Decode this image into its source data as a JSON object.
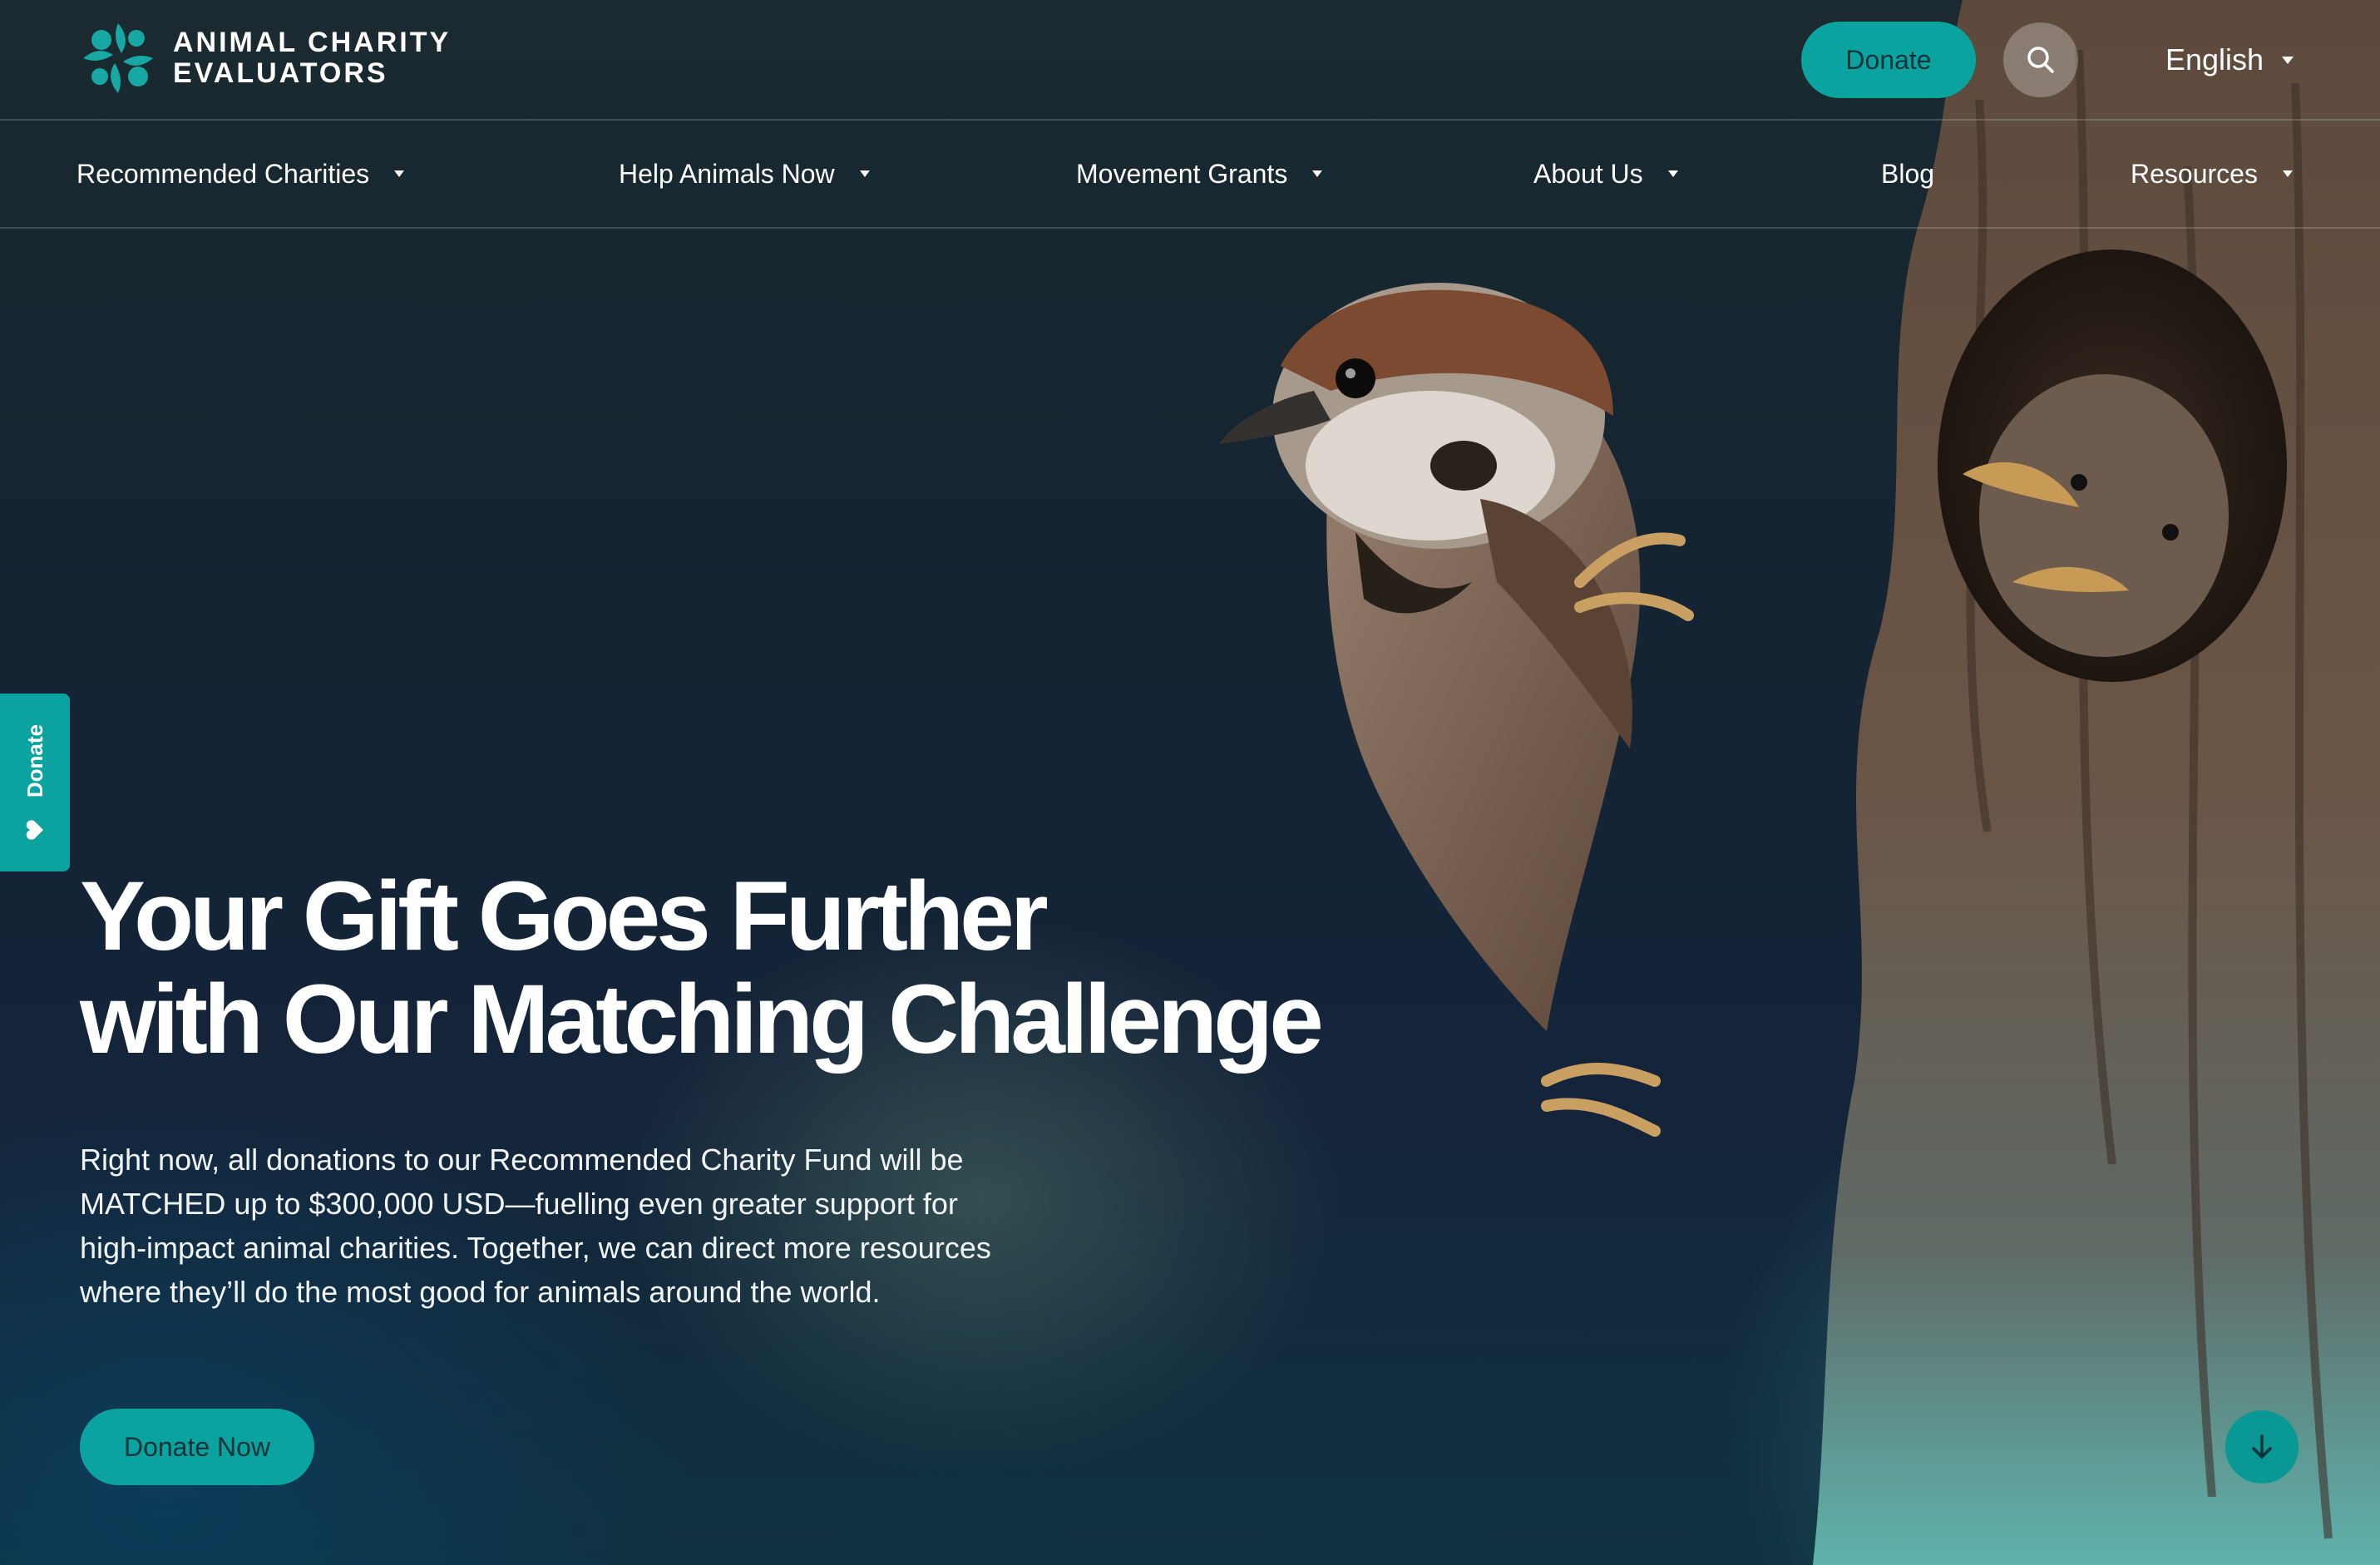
{
  "brand": {
    "name_line1": "ANIMAL CHARITY",
    "name_line2": "EVALUATORS",
    "accent_color": "#0aa3a0"
  },
  "header": {
    "donate_label": "Donate",
    "search_icon": "search-icon",
    "language": "English"
  },
  "nav": {
    "items": [
      {
        "label": "Recommended Charities",
        "has_dropdown": true
      },
      {
        "label": "Help Animals Now",
        "has_dropdown": true
      },
      {
        "label": "Movement Grants",
        "has_dropdown": true
      },
      {
        "label": "About Us",
        "has_dropdown": true
      },
      {
        "label": "Blog",
        "has_dropdown": false
      },
      {
        "label": "Resources",
        "has_dropdown": true
      }
    ]
  },
  "side_tab": {
    "label": "Donate",
    "icon": "heart-icon"
  },
  "hero": {
    "headline_line1": "Your Gift Goes Further",
    "headline_line2": "with Our Matching Challenge",
    "intro": "Right now, all donations to our Recommended Charity Fund will be MATCHED up to $300,000 USD—fuelling even greater support for high-impact animal charities. Together, we can direct more resources where they’ll do the most good for animals around the world.",
    "cta_label": "Donate Now",
    "scroll_icon": "arrow-down-icon",
    "image": "sparrows-on-tree-trunk"
  }
}
